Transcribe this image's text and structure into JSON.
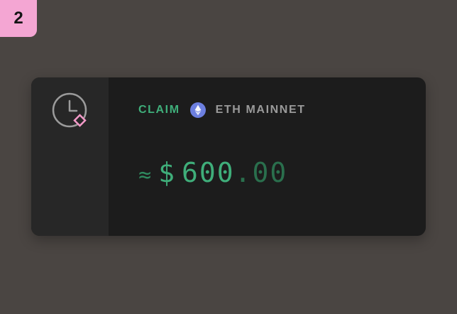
{
  "step": {
    "number": "2"
  },
  "card": {
    "status_icon": "clock-with-diamond-icon",
    "label": "CLAIM",
    "network_icon": "ethereum-icon",
    "network": "ETH MAINNET",
    "approx_symbol": "≈",
    "currency_symbol": "$",
    "amount_integer": "600",
    "amount_decimal": ".00"
  },
  "colors": {
    "background": "#4a4542",
    "badge": "#f4a6d3",
    "card": "#1c1c1c",
    "rail": "#272727",
    "accent_green": "#3fae7a",
    "muted_text": "#9a9a9a",
    "eth_blue": "#6c7fe0",
    "diamond_pink": "#f49ac9"
  }
}
